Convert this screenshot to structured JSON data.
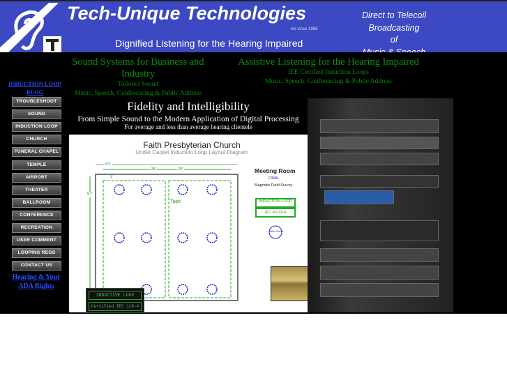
{
  "header": {
    "title": "Tech-Unique Technologies",
    "since": "inc since 1988",
    "tagline": "Dignified Listening for the Hearing Impaired",
    "right_lines": [
      "Direct to Telecoil",
      "Broadcasting",
      "of",
      "Music & Speech"
    ]
  },
  "columns": [
    {
      "heading": "Sound Systems for Business and Industry",
      "lines": [
        "Tailored Sound",
        "Music, Speech, Conferencing & Public Address"
      ]
    },
    {
      "heading": "Assistive Listening for the Hearing Impaired",
      "lines": [
        "IEE Certified Induction Loops",
        "Music, Speech, Conferencing & Public Address"
      ]
    }
  ],
  "nav": {
    "top_link": "INDUCTION LOOP BLOG",
    "buttons": [
      "TROUBLESHOOT",
      "SOUND",
      "INDUCTION LOOP",
      "CHURCH",
      "FUNERAL CHAPEL",
      "TEMPLE",
      "AIRPORT",
      "THEATER",
      "BALLROOM",
      "CONFERENCE",
      "RECREATION",
      "USER COMMENT",
      "LOOPING REGS",
      "CONTACT US"
    ],
    "bottom_link": "Hearing & Your ADA Rights"
  },
  "feature": {
    "title": "Fidelity and Intelligibility",
    "subtitle": "From Simple Sound to the Modern Application of Digital Processing",
    "note": "For average and less than average hearing clientele"
  },
  "diagram": {
    "title": "Faith Presbyterian Church",
    "subtitle": "Under Carpet Induction Loop Layout Diagram",
    "room": "Meeting Room",
    "final": "FINAL",
    "survey": "Magnetic Field Survey",
    "badge1": "INDUCTION LOOP",
    "badge2": "IEC 60118-4",
    "tape": "Tape",
    "dims": [
      "63'",
      "28'",
      "28'",
      "3'",
      "57'"
    ],
    "overlay1": "INDUCTIVE LOOP",
    "overlay2": "Certified IEC 118-4",
    "noise": "1kHz Noise"
  },
  "colors": {
    "header_bg": "#3c49c2",
    "green_text": "#0a8a0a",
    "link": "#2a4cff"
  }
}
